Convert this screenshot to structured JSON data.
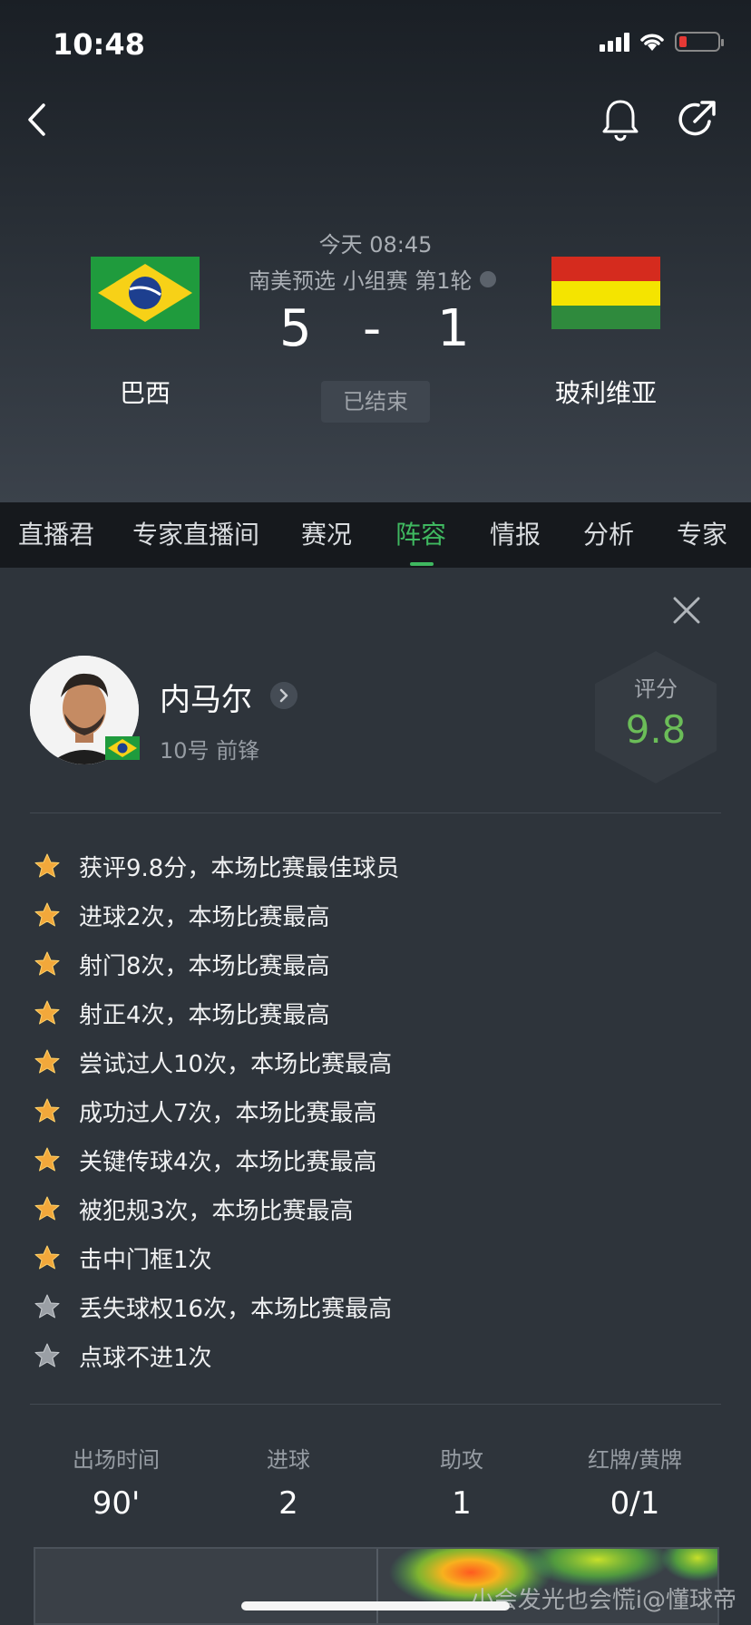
{
  "status_bar": {
    "time": "10:48"
  },
  "match": {
    "time": "今天 08:45",
    "league": "南美预选 小组赛 第1轮",
    "home_team": "巴西",
    "away_team": "玻利维亚",
    "home_score": "5",
    "separator": "-",
    "away_score": "1",
    "status": "已结束"
  },
  "tabs": [
    {
      "label": "直播君"
    },
    {
      "label": "专家直播间"
    },
    {
      "label": "赛况"
    },
    {
      "label": "阵容",
      "active": true
    },
    {
      "label": "情报"
    },
    {
      "label": "分析"
    },
    {
      "label": "专家"
    }
  ],
  "player": {
    "name": "内马尔",
    "meta": "10号 前锋",
    "rating_label": "评分",
    "rating_value": "9.8"
  },
  "achievements": [
    {
      "text": "获评9.8分，本场比赛最佳球员",
      "type": "gold"
    },
    {
      "text": "进球2次，本场比赛最高",
      "type": "gold"
    },
    {
      "text": "射门8次，本场比赛最高",
      "type": "gold"
    },
    {
      "text": "射正4次，本场比赛最高",
      "type": "gold"
    },
    {
      "text": "尝试过人10次，本场比赛最高",
      "type": "gold"
    },
    {
      "text": "成功过人7次，本场比赛最高",
      "type": "gold"
    },
    {
      "text": "关键传球4次，本场比赛最高",
      "type": "gold"
    },
    {
      "text": "被犯规3次，本场比赛最高",
      "type": "gold"
    },
    {
      "text": "击中门框1次",
      "type": "gold"
    },
    {
      "text": "丢失球权16次，本场比赛最高",
      "type": "silver"
    },
    {
      "text": "点球不进1次",
      "type": "silver"
    }
  ],
  "stats": [
    {
      "label": "出场时间",
      "value": "90'"
    },
    {
      "label": "进球",
      "value": "2"
    },
    {
      "label": "助攻",
      "value": "1"
    },
    {
      "label": "红牌/黄牌",
      "value": "0/1"
    }
  ],
  "watermark": "小会发光也会慌i@懂球帝",
  "colors": {
    "accent_green": "#3fb860",
    "rating_green": "#6bbd58",
    "star_gold": "#f2a83b",
    "star_silver": "#9a9fa5"
  },
  "icons": {
    "back": "chevron-left-icon",
    "notify": "bell-icon",
    "share": "share-arrow-icon",
    "close": "close-icon",
    "detail": "chevron-right-icon",
    "achievement": "star-icon"
  }
}
